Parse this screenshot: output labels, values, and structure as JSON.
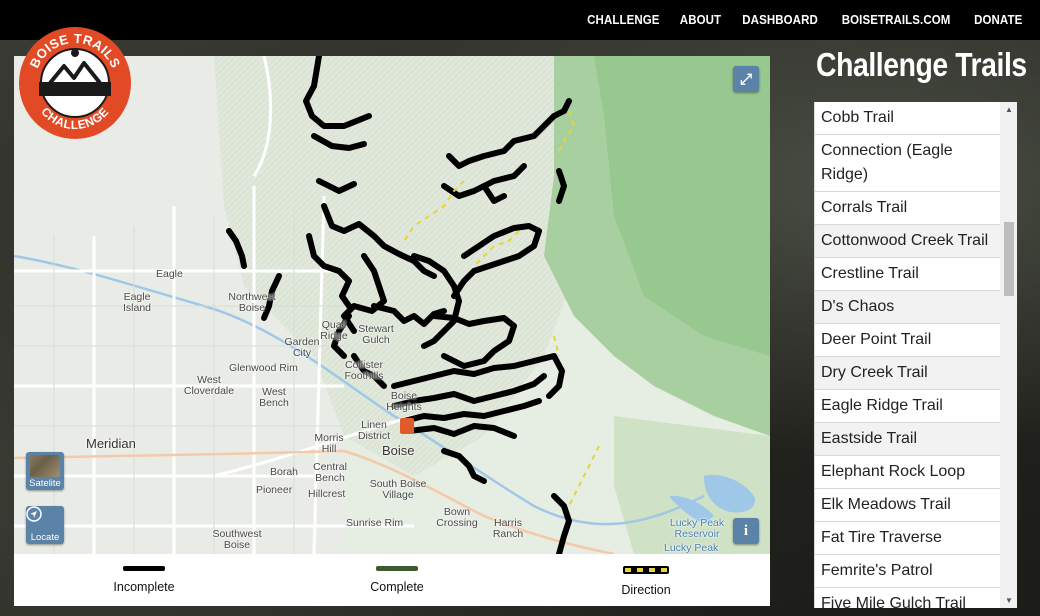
{
  "nav": {
    "items": [
      "CHALLENGE",
      "ABOUT",
      "DASHBOARD",
      "BOISETRAILS.COM",
      "DONATE"
    ]
  },
  "logo": {
    "text_top": "BOISE TRAILS",
    "text_bottom": "CHALLENGE",
    "colors": {
      "ring": "#e24a26",
      "band": "#1a1a1a",
      "inner": "#ffffff"
    }
  },
  "map": {
    "fullscreen_icon": "expand-icon",
    "info_label": "i",
    "satellite_label": "Satelite",
    "locate_label": "Locate",
    "place_labels": [
      "Eagle",
      "Eagle Island",
      "Northwest Boise",
      "Quail Ridge",
      "Stewart Gulch",
      "Garden City",
      "Collister Foothills",
      "Glenwood Rim",
      "West Cloverdale",
      "West Bench",
      "Boise Heights",
      "Meridian",
      "Morris Hill",
      "Linen District",
      "Boise",
      "Borah",
      "Central Bench",
      "Pioneer",
      "Hillcrest",
      "South Boise Village",
      "Sunrise Rim",
      "Bown Crossing",
      "Harris Ranch",
      "Southwest Boise",
      "Lucky Peak Reservoir",
      "Lucky Peak"
    ],
    "colors": {
      "terrain": "#e6ede3",
      "forest": "#9cc99a",
      "water": "#9fc8e8",
      "road": "#ffffff"
    }
  },
  "legend": [
    {
      "label": "Incomplete",
      "color": "#000000"
    },
    {
      "label": "Complete",
      "color": "#3f5a2e"
    },
    {
      "label": "Direction",
      "color": "#e7d43a"
    }
  ],
  "sidebar": {
    "title": "Challenge Trails",
    "trails": [
      "Cobb Trail",
      "Connection (Eagle Ridge)",
      "Corrals Trail",
      "Cottonwood Creek Trail",
      "Crestline Trail",
      "D's Chaos",
      "Deer Point Trail",
      "Dry Creek Trail",
      "Eagle Ridge Trail",
      "Eastside Trail",
      "Elephant Rock Loop",
      "Elk Meadows Trail",
      "Fat Tire Traverse",
      "Femrite's Patrol",
      "Five Mile Gulch Trail"
    ]
  }
}
